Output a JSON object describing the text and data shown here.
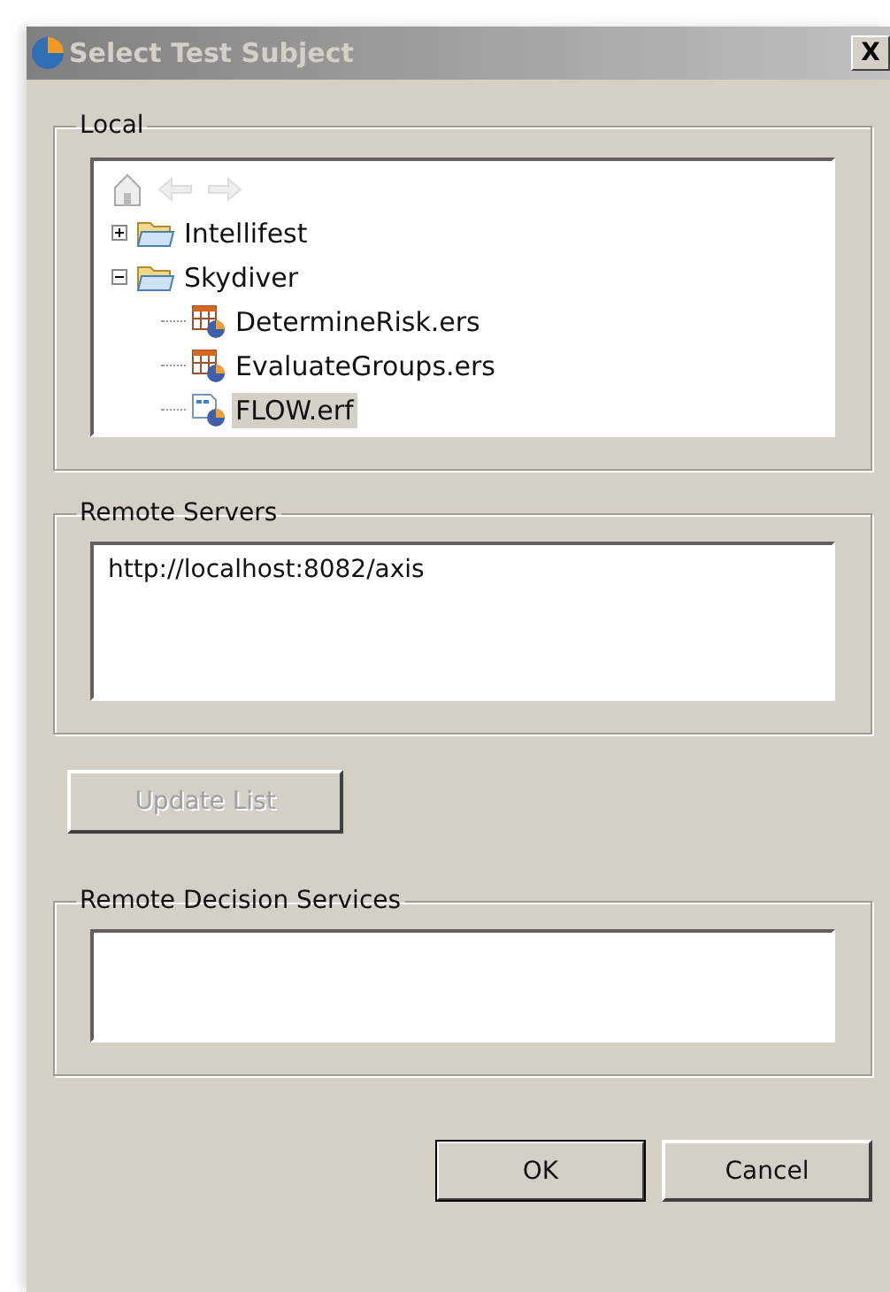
{
  "window": {
    "title": "Select Test Subject",
    "close": "X"
  },
  "local": {
    "label": "Local",
    "tree": [
      {
        "label": "Intellifest",
        "kind": "folder",
        "expanded": false,
        "selected": false
      },
      {
        "label": "Skydiver",
        "kind": "folder",
        "expanded": true,
        "selected": false,
        "children": [
          {
            "label": "DetermineRisk.ers",
            "kind": "ruleset",
            "selected": false
          },
          {
            "label": "EvaluateGroups.ers",
            "kind": "ruleset",
            "selected": false
          },
          {
            "label": "FLOW.erf",
            "kind": "flow",
            "selected": true
          }
        ]
      }
    ]
  },
  "remote_servers": {
    "label": "Remote Servers",
    "items": [
      "http://localhost:8082/axis"
    ]
  },
  "update_button": {
    "label": "Update List",
    "disabled": true
  },
  "remote_decision_services": {
    "label": "Remote Decision Services"
  },
  "buttons": [
    {
      "label": "OK",
      "default": true
    },
    {
      "label": "Cancel",
      "default": false
    }
  ]
}
